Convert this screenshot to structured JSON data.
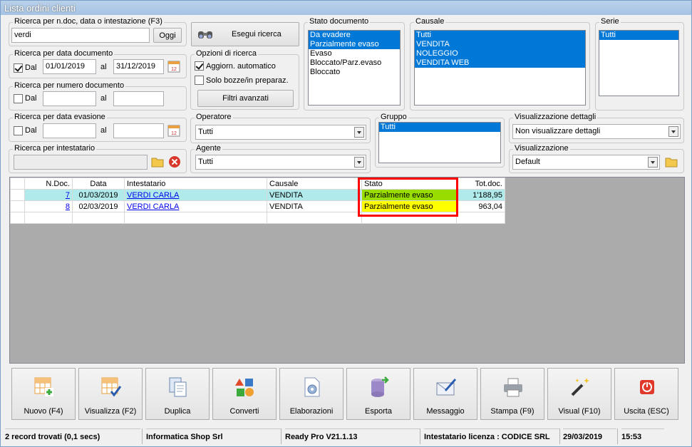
{
  "window": {
    "title": "Lista ordini clienti"
  },
  "search_text": {
    "legend": "Ricerca per n.doc, data o intestazione (F3)",
    "value": "verdi",
    "oggi_label": "Oggi"
  },
  "execute_search": {
    "label": "Esegui ricerca"
  },
  "date_search": {
    "legend": "Ricerca per data documento",
    "dal_label": "Dal",
    "dal_checked": true,
    "from": "01/01/2019",
    "al_label": "al",
    "to": "31/12/2019"
  },
  "number_search": {
    "legend": "Ricerca per numero documento",
    "dal_label": "Dal",
    "dal_checked": false,
    "from": "",
    "al_label": "al",
    "to": ""
  },
  "evasion_search": {
    "legend": "Ricerca per data evasione",
    "dal_label": "Dal",
    "dal_checked": false,
    "from": "",
    "al_label": "al",
    "to": ""
  },
  "holder_search": {
    "legend": "Ricerca per intestatario",
    "value": ""
  },
  "search_options": {
    "legend": "Opzioni di ricerca",
    "auto_update_label": "Aggiorn. automatico",
    "auto_update_checked": true,
    "drafts_label": "Solo bozze/in preparaz.",
    "drafts_checked": false,
    "advanced_label": "Filtri avanzati"
  },
  "doc_state": {
    "legend": "Stato documento",
    "items": [
      {
        "label": "Da evadere",
        "selected": true
      },
      {
        "label": "Parzialmente evaso",
        "selected": true
      },
      {
        "label": "Evaso",
        "selected": false
      },
      {
        "label": "Bloccato/Parz.evaso",
        "selected": false
      },
      {
        "label": "Bloccato",
        "selected": false
      }
    ]
  },
  "causale": {
    "legend": "Causale",
    "items": [
      {
        "label": "Tutti",
        "selected": true
      },
      {
        "label": "VENDITA",
        "selected": true
      },
      {
        "label": "NOLEGGIO",
        "selected": true
      },
      {
        "label": "VENDITA WEB",
        "selected": true
      }
    ]
  },
  "serie": {
    "legend": "Serie",
    "items": [
      {
        "label": "Tutti",
        "selected": true
      }
    ]
  },
  "operatore": {
    "legend": "Operatore",
    "value": "Tutti"
  },
  "agente": {
    "legend": "Agente",
    "value": "Tutti"
  },
  "gruppo": {
    "legend": "Gruppo",
    "items": [
      {
        "label": "Tutti",
        "selected": true
      }
    ]
  },
  "details_view": {
    "legend": "Visualizzazione dettagli",
    "value": "Non visualizzare dettagli"
  },
  "view": {
    "legend": "Visualizzazione",
    "value": "Default"
  },
  "grid": {
    "headers": {
      "ndoc": "N.Doc.",
      "data": "Data",
      "intestatario": "Intestatario",
      "causale": "Causale",
      "stato": "Stato",
      "tot": "Tot.doc."
    },
    "rows": [
      {
        "ndoc": "7",
        "data": "01/03/2019",
        "intestatario": "VERDI CARLA",
        "causale": "VENDITA",
        "stato": "Parzialmente evaso",
        "tot": "1'188,95"
      },
      {
        "ndoc": "8",
        "data": "02/03/2019",
        "intestatario": "VERDI CARLA",
        "causale": "VENDITA",
        "stato": "Parzialmente evaso",
        "tot": "963,04"
      }
    ],
    "highlight_color": "#ff0000",
    "selected_row_color": "#b0eaea",
    "state_colors": {
      "row1": "#99dd00",
      "row2": "#ffff00"
    }
  },
  "toolbar": [
    {
      "label": "Nuovo (F4)",
      "icon": "new-grid-icon"
    },
    {
      "label": "Visualizza (F2)",
      "icon": "view-grid-icon"
    },
    {
      "label": "Duplica",
      "icon": "duplicate-icon"
    },
    {
      "label": "Converti",
      "icon": "convert-icon"
    },
    {
      "label": "Elaborazioni",
      "icon": "process-icon"
    },
    {
      "label": "Esporta",
      "icon": "export-icon"
    },
    {
      "label": "Messaggio",
      "icon": "message-icon"
    },
    {
      "label": "Stampa (F9)",
      "icon": "printer-icon"
    },
    {
      "label": "Visual (F10)",
      "icon": "magic-wand-icon"
    },
    {
      "label": "Uscita (ESC)",
      "icon": "exit-icon"
    }
  ],
  "status": {
    "records": "2 record trovati (0,1 secs)",
    "company": "Informatica Shop Srl",
    "version": "Ready Pro V21.1.13",
    "license": "Intestatario licenza : CODICE SRL",
    "date": "29/03/2019",
    "time": "15:53"
  }
}
